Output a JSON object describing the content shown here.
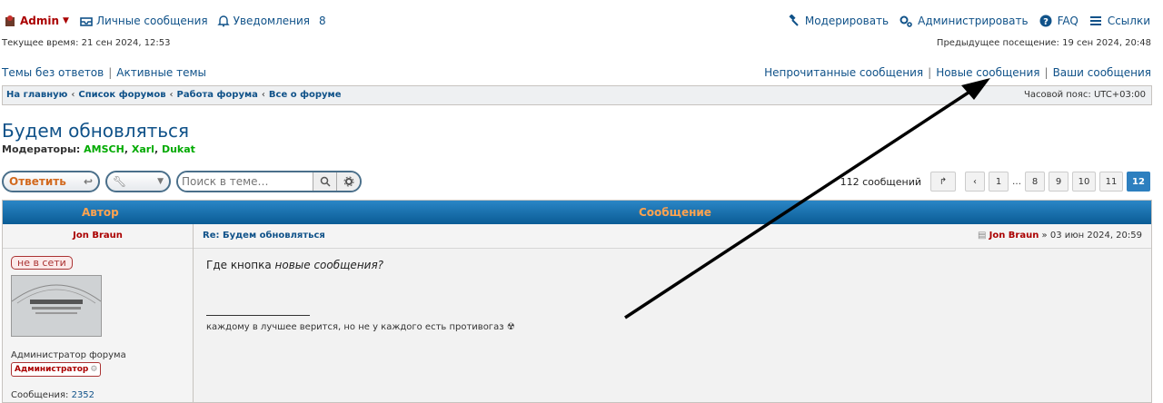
{
  "header": {
    "username": "Admin",
    "messages_label": "Личные сообщения",
    "notifications_label": "Уведомления",
    "notifications_count": "8",
    "moderate_label": "Модерировать",
    "administer_label": "Администрировать",
    "faq_label": "FAQ",
    "links_label": "Ссылки"
  },
  "times": {
    "current": "Текущее время: 21 сен 2024, 12:53",
    "last_visit": "Предыдущее посещение: 19 сен 2024, 20:48"
  },
  "quicklinks": {
    "left": [
      "Темы без ответов",
      "Активные темы"
    ],
    "right": [
      "Непрочитанные сообщения",
      "Новые сообщения",
      "Ваши сообщения"
    ]
  },
  "breadcrumbs": [
    "На главную",
    "Список форумов",
    "Работа форума",
    "Все о форуме"
  ],
  "timezone": "Часовой пояс: UTC+03:00",
  "topic": {
    "title": "Будем обновляться",
    "moderators_label": "Модераторы:",
    "moderators": [
      "AMSCH",
      "Xarl",
      "Dukat"
    ]
  },
  "toolbar": {
    "reply_label": "Ответить",
    "search_placeholder": "Поиск в теме…"
  },
  "pagination": {
    "total": "112 сообщений",
    "pages": [
      "1",
      "8",
      "9",
      "10",
      "11",
      "12"
    ],
    "dots": "…",
    "current": "12"
  },
  "table": {
    "author_header": "Автор",
    "message_header": "Сообщение"
  },
  "post": {
    "author": "Jon Braun",
    "status": "не в сети",
    "rank": "Администратор форума",
    "rank_badge": "Администратор",
    "posts_label": "Сообщения:",
    "posts_count": "2352",
    "title": "Re: Будем обновляться",
    "meta_author": "Jon Braun",
    "meta_date": "» 03 июн 2024, 20:59",
    "body_prefix": "Где кнопка ",
    "body_italic": "новые сообщения?",
    "signature": "каждому в лучшее верится, но не у каждого есть противогаз ☢"
  },
  "colors": {
    "link": "#105289",
    "admin": "#AA0000",
    "moderator": "#00AA00",
    "header_bar": "#0a5c95",
    "header_text": "#ffa34f"
  }
}
